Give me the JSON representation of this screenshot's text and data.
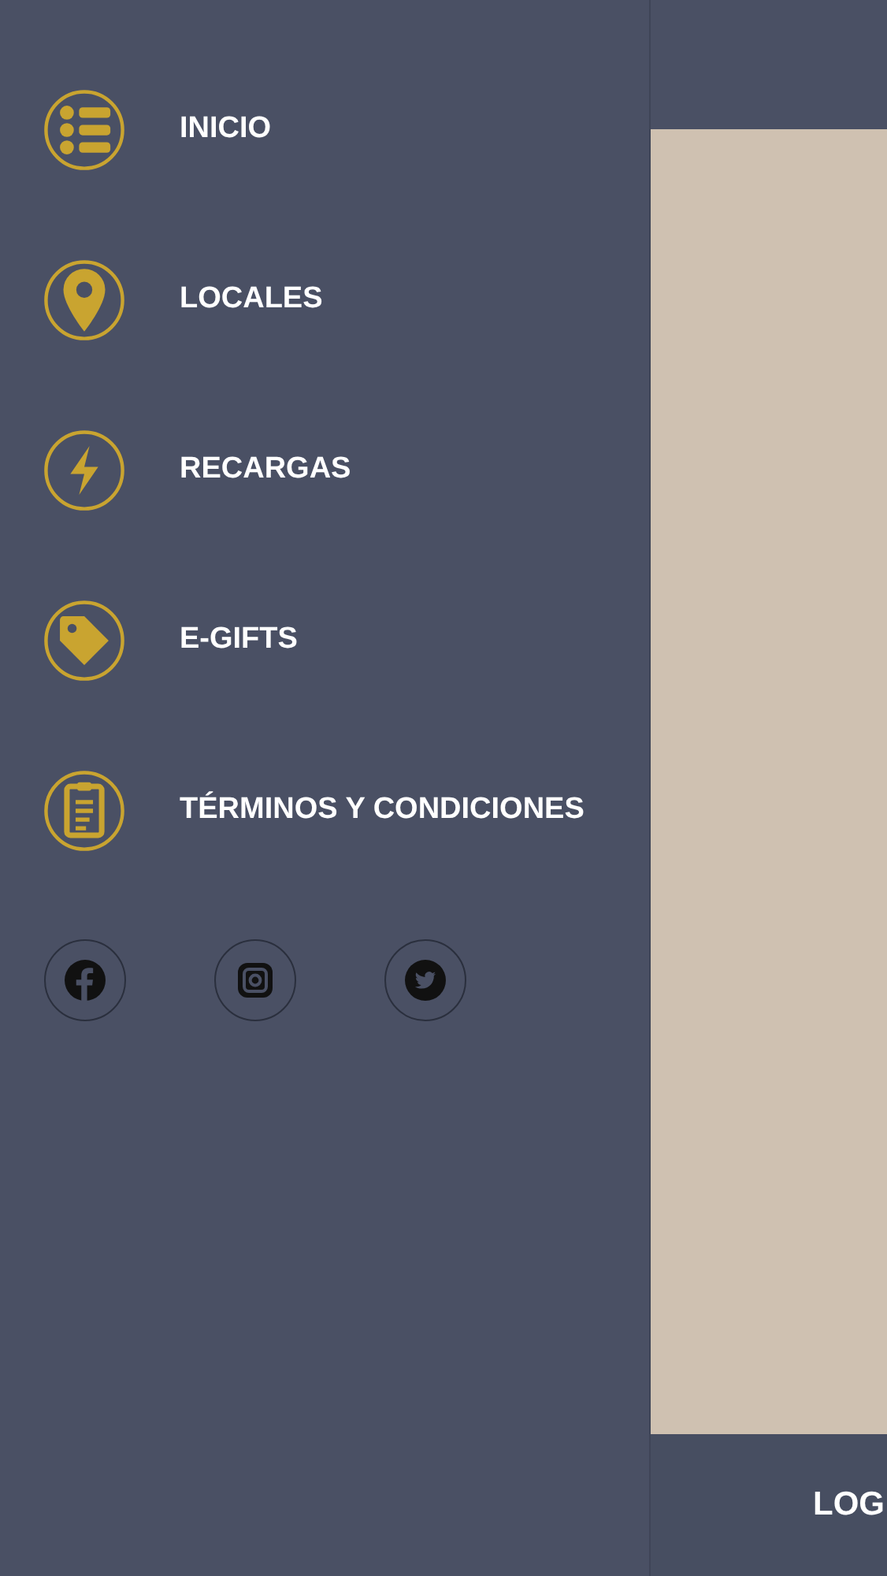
{
  "menu": [
    {
      "label": "INICIO"
    },
    {
      "label": "LOCALES"
    },
    {
      "label": "RECARGAS"
    },
    {
      "label": "E-GIFTS"
    },
    {
      "label": "TÉRMINOS Y CONDICIONES"
    }
  ],
  "bottom_bar": {
    "label": "LOG"
  }
}
